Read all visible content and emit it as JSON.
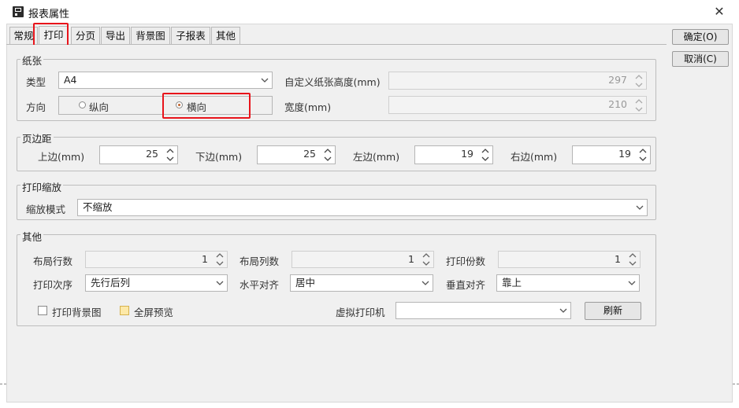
{
  "window": {
    "title": "报表属性",
    "close_icon": "close-icon"
  },
  "tabs": [
    {
      "label": "常规"
    },
    {
      "label": "打印",
      "active": true
    },
    {
      "label": "分页"
    },
    {
      "label": "导出"
    },
    {
      "label": "背景图"
    },
    {
      "label": "子报表"
    },
    {
      "label": "其他"
    }
  ],
  "buttons": {
    "ok": "确定(O)",
    "cancel": "取消(C)",
    "refresh": "刷新"
  },
  "paper": {
    "legend": "纸张",
    "type_label": "类型",
    "type_value": "A4",
    "orientation_label": "方向",
    "portrait": "纵向",
    "landscape": "横向",
    "selected": "横向",
    "custom_height_label": "自定义纸张高度(mm)",
    "custom_height_value": "297",
    "width_label": "宽度(mm)",
    "width_value": "210"
  },
  "margins": {
    "legend": "页边距",
    "top_label": "上边(mm)",
    "top_value": "25",
    "bottom_label": "下边(mm)",
    "bottom_value": "25",
    "left_label": "左边(mm)",
    "left_value": "19",
    "right_label": "右边(mm)",
    "right_value": "19"
  },
  "scale": {
    "legend": "打印缩放",
    "mode_label": "缩放模式",
    "mode_value": "不缩放"
  },
  "other": {
    "legend": "其他",
    "rows_label": "布局行数",
    "rows_value": "1",
    "cols_label": "布局列数",
    "cols_value": "1",
    "copies_label": "打印份数",
    "copies_value": "1",
    "order_label": "打印次序",
    "order_value": "先行后列",
    "halign_label": "水平对齐",
    "halign_value": "居中",
    "valign_label": "垂直对齐",
    "valign_value": "靠上",
    "print_bg_label": "打印背景图",
    "print_bg_checked": false,
    "fullscreen_label": "全屏预览",
    "fullscreen_checked": false,
    "virtual_printer_label": "虚拟打印机",
    "virtual_printer_value": ""
  },
  "colors": {
    "highlight": "#e8141b",
    "radio_selected": "#c0622a",
    "background": "#f0f0f0"
  }
}
